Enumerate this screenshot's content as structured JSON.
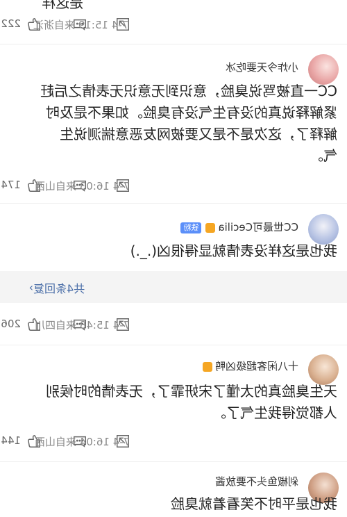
{
  "top_meta": {
    "time_location": "7-4 15:19 来自浙江",
    "likes": "222",
    "partial_text": "是这样"
  },
  "comments": [
    {
      "username": "小炸今天要吃冰",
      "text": "CC一直被骂说臭脸，意识到无意识无表情之后赶紧解释说真的没有生气没有臭脸。如果不是及时解释了，这次是不是又要被网友恶意揣测说生气。",
      "time_location": "7-4 16:03 来自山西",
      "likes": "174"
    },
    {
      "username": "CC世最可Cecilia",
      "badge": "铁粉",
      "text": "我也是这样没表情就显得很凶(._.)",
      "reply_link": "共4条回复",
      "time_location": "7-4 15:48 来自四川",
      "likes": "206"
    },
    {
      "username": "十八闲客超级凶鸭",
      "text": "天生臭脸真的太懂了宋妍霏了，无表情的时候别人都觉得我生气了。",
      "time_location": "7-4 16:04 来自山西",
      "likes": "144"
    },
    {
      "username": "剁椒鱼头不要放酱",
      "text": "我也是平时不笑看着就臭脸"
    }
  ],
  "colors": {
    "badge_blue": "#5b8ff9",
    "crown_orange": "#f5a623",
    "meta_grey": "#888888",
    "link_blue": "#4a6ea8"
  },
  "icons": [
    "like-icon",
    "comment-icon",
    "share-icon",
    "reply-chevron-icon",
    "crown-icon"
  ]
}
